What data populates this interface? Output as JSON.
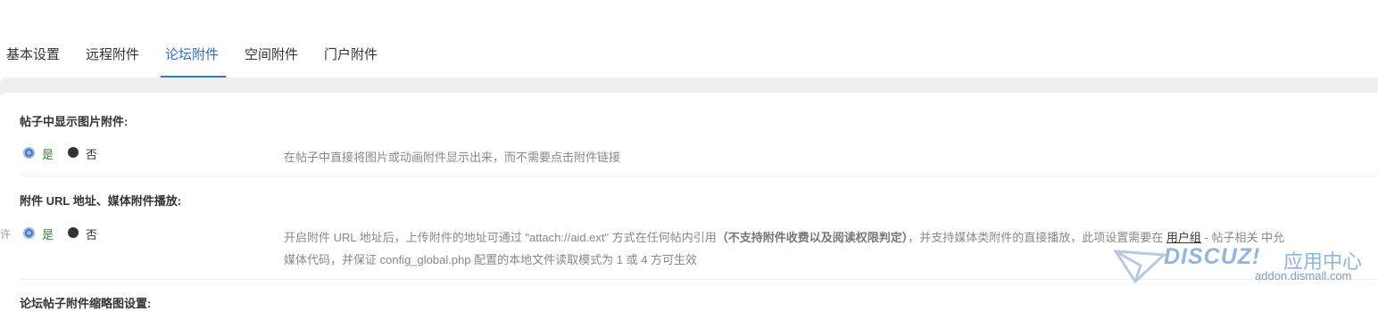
{
  "tabs": [
    {
      "label": "基本设置"
    },
    {
      "label": "远程附件"
    },
    {
      "label": "论坛附件"
    },
    {
      "label": "空间附件"
    },
    {
      "label": "门户附件"
    }
  ],
  "active_tab": "论坛附件",
  "settings": [
    {
      "title": "帖子中显示图片附件:",
      "yes": "是",
      "no": "否",
      "selected": "是",
      "description": "在帖子中直接将图片或动画附件显示出来，而不需要点击附件链接"
    },
    {
      "title": "附件 URL 地址、媒体附件播放:",
      "yes": "是",
      "no": "否",
      "selected": "是",
      "desc_part1": "开启附件 URL 地址后，上传附件的地址可通过 \"attach://aid.ext\" 方式在任何帖内引用",
      "desc_bold": "（不支持附件收费以及阅读权限判定）",
      "desc_part2": "，并支持媒体类附件的直接播放，此项设置需要在",
      "desc_link": "用户组",
      "desc_part3": "- 帖子相关 中允",
      "desc_line2": "媒体代码，并保证 config_global.php 配置的本地文件读取模式为 1 或 4 方可生效",
      "left_cut_char": "许"
    }
  ],
  "next_setting_title": "论坛帖子附件缩略图设置:",
  "watermark": {
    "brand": "DISCUZ!",
    "cn": "应用中心",
    "url": "addon.dismall.com"
  },
  "colors": {
    "accent": "#3a76c4",
    "yes_green": "#2f8a2f",
    "desc_gray": "#888888"
  }
}
